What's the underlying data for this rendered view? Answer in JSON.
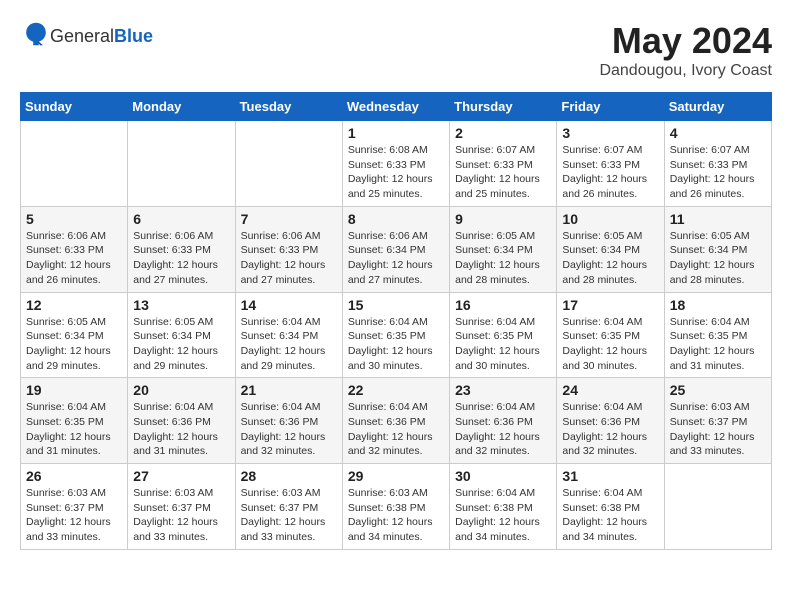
{
  "header": {
    "logo_general": "General",
    "logo_blue": "Blue",
    "title": "May 2024",
    "location": "Dandougou, Ivory Coast"
  },
  "weekdays": [
    "Sunday",
    "Monday",
    "Tuesday",
    "Wednesday",
    "Thursday",
    "Friday",
    "Saturday"
  ],
  "weeks": [
    [
      {
        "day": "",
        "info": ""
      },
      {
        "day": "",
        "info": ""
      },
      {
        "day": "",
        "info": ""
      },
      {
        "day": "1",
        "info": "Sunrise: 6:08 AM\nSunset: 6:33 PM\nDaylight: 12 hours\nand 25 minutes."
      },
      {
        "day": "2",
        "info": "Sunrise: 6:07 AM\nSunset: 6:33 PM\nDaylight: 12 hours\nand 25 minutes."
      },
      {
        "day": "3",
        "info": "Sunrise: 6:07 AM\nSunset: 6:33 PM\nDaylight: 12 hours\nand 26 minutes."
      },
      {
        "day": "4",
        "info": "Sunrise: 6:07 AM\nSunset: 6:33 PM\nDaylight: 12 hours\nand 26 minutes."
      }
    ],
    [
      {
        "day": "5",
        "info": "Sunrise: 6:06 AM\nSunset: 6:33 PM\nDaylight: 12 hours\nand 26 minutes."
      },
      {
        "day": "6",
        "info": "Sunrise: 6:06 AM\nSunset: 6:33 PM\nDaylight: 12 hours\nand 27 minutes."
      },
      {
        "day": "7",
        "info": "Sunrise: 6:06 AM\nSunset: 6:33 PM\nDaylight: 12 hours\nand 27 minutes."
      },
      {
        "day": "8",
        "info": "Sunrise: 6:06 AM\nSunset: 6:34 PM\nDaylight: 12 hours\nand 27 minutes."
      },
      {
        "day": "9",
        "info": "Sunrise: 6:05 AM\nSunset: 6:34 PM\nDaylight: 12 hours\nand 28 minutes."
      },
      {
        "day": "10",
        "info": "Sunrise: 6:05 AM\nSunset: 6:34 PM\nDaylight: 12 hours\nand 28 minutes."
      },
      {
        "day": "11",
        "info": "Sunrise: 6:05 AM\nSunset: 6:34 PM\nDaylight: 12 hours\nand 28 minutes."
      }
    ],
    [
      {
        "day": "12",
        "info": "Sunrise: 6:05 AM\nSunset: 6:34 PM\nDaylight: 12 hours\nand 29 minutes."
      },
      {
        "day": "13",
        "info": "Sunrise: 6:05 AM\nSunset: 6:34 PM\nDaylight: 12 hours\nand 29 minutes."
      },
      {
        "day": "14",
        "info": "Sunrise: 6:04 AM\nSunset: 6:34 PM\nDaylight: 12 hours\nand 29 minutes."
      },
      {
        "day": "15",
        "info": "Sunrise: 6:04 AM\nSunset: 6:35 PM\nDaylight: 12 hours\nand 30 minutes."
      },
      {
        "day": "16",
        "info": "Sunrise: 6:04 AM\nSunset: 6:35 PM\nDaylight: 12 hours\nand 30 minutes."
      },
      {
        "day": "17",
        "info": "Sunrise: 6:04 AM\nSunset: 6:35 PM\nDaylight: 12 hours\nand 30 minutes."
      },
      {
        "day": "18",
        "info": "Sunrise: 6:04 AM\nSunset: 6:35 PM\nDaylight: 12 hours\nand 31 minutes."
      }
    ],
    [
      {
        "day": "19",
        "info": "Sunrise: 6:04 AM\nSunset: 6:35 PM\nDaylight: 12 hours\nand 31 minutes."
      },
      {
        "day": "20",
        "info": "Sunrise: 6:04 AM\nSunset: 6:36 PM\nDaylight: 12 hours\nand 31 minutes."
      },
      {
        "day": "21",
        "info": "Sunrise: 6:04 AM\nSunset: 6:36 PM\nDaylight: 12 hours\nand 32 minutes."
      },
      {
        "day": "22",
        "info": "Sunrise: 6:04 AM\nSunset: 6:36 PM\nDaylight: 12 hours\nand 32 minutes."
      },
      {
        "day": "23",
        "info": "Sunrise: 6:04 AM\nSunset: 6:36 PM\nDaylight: 12 hours\nand 32 minutes."
      },
      {
        "day": "24",
        "info": "Sunrise: 6:04 AM\nSunset: 6:36 PM\nDaylight: 12 hours\nand 32 minutes."
      },
      {
        "day": "25",
        "info": "Sunrise: 6:03 AM\nSunset: 6:37 PM\nDaylight: 12 hours\nand 33 minutes."
      }
    ],
    [
      {
        "day": "26",
        "info": "Sunrise: 6:03 AM\nSunset: 6:37 PM\nDaylight: 12 hours\nand 33 minutes."
      },
      {
        "day": "27",
        "info": "Sunrise: 6:03 AM\nSunset: 6:37 PM\nDaylight: 12 hours\nand 33 minutes."
      },
      {
        "day": "28",
        "info": "Sunrise: 6:03 AM\nSunset: 6:37 PM\nDaylight: 12 hours\nand 33 minutes."
      },
      {
        "day": "29",
        "info": "Sunrise: 6:03 AM\nSunset: 6:38 PM\nDaylight: 12 hours\nand 34 minutes."
      },
      {
        "day": "30",
        "info": "Sunrise: 6:04 AM\nSunset: 6:38 PM\nDaylight: 12 hours\nand 34 minutes."
      },
      {
        "day": "31",
        "info": "Sunrise: 6:04 AM\nSunset: 6:38 PM\nDaylight: 12 hours\nand 34 minutes."
      },
      {
        "day": "",
        "info": ""
      }
    ]
  ]
}
